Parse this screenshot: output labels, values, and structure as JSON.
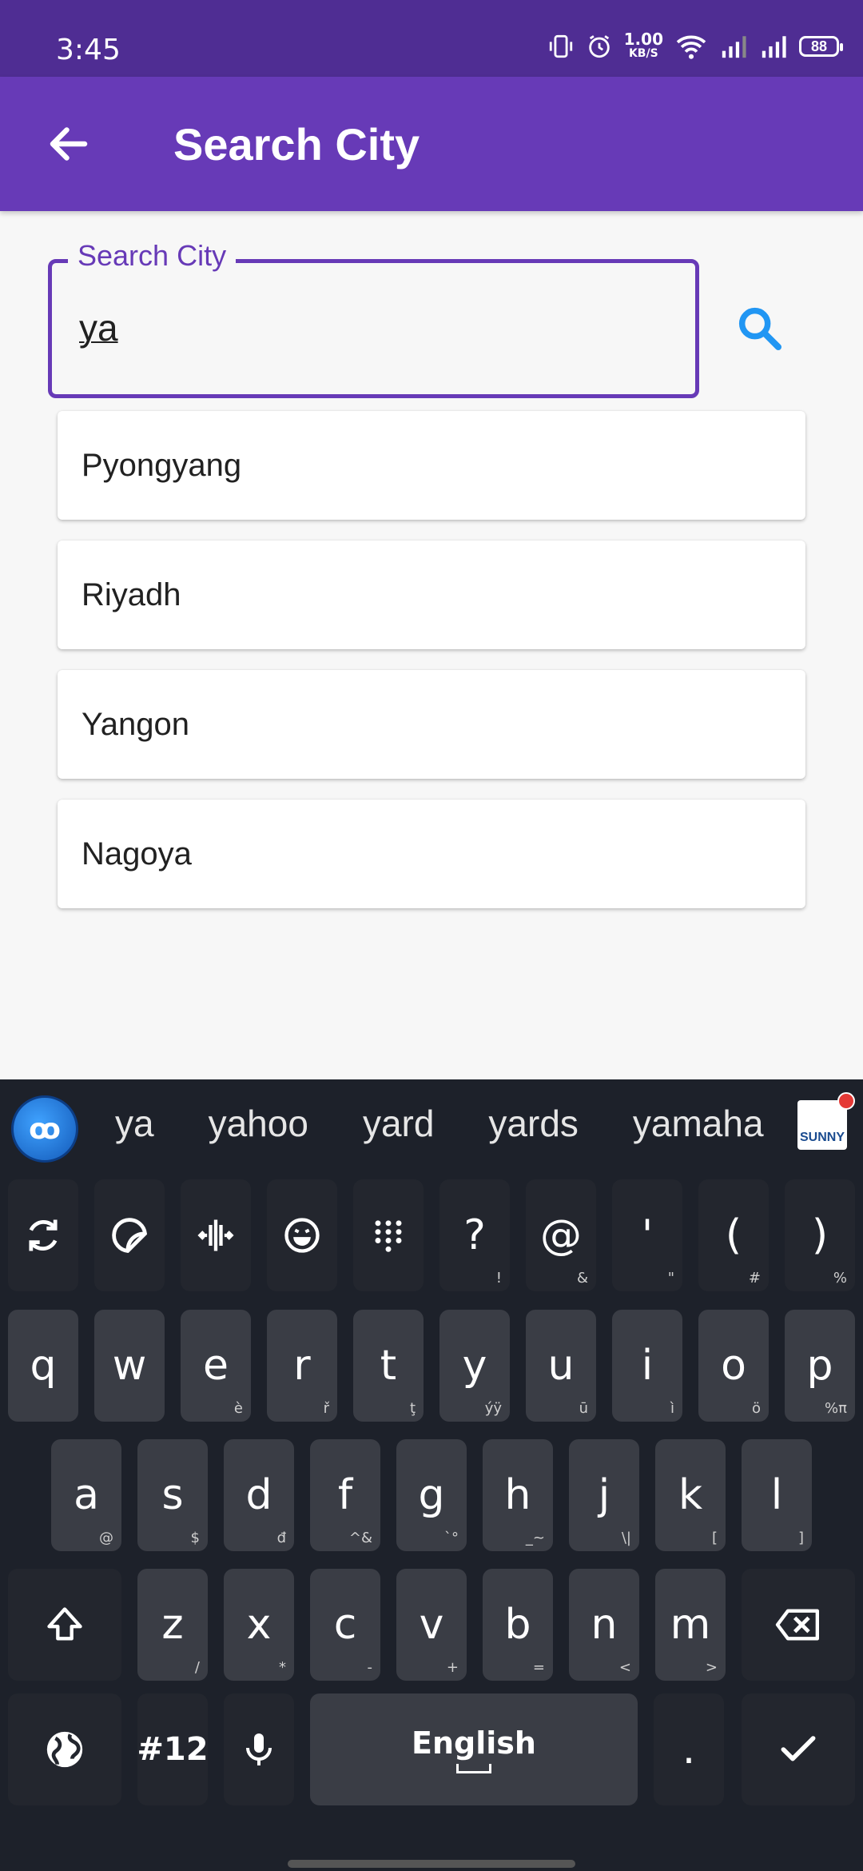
{
  "status_bar": {
    "time": "3:45",
    "net_speed_value": "1.00",
    "net_speed_unit": "KB/S",
    "battery": "88",
    "icons": [
      "vibrate-icon",
      "alarm-icon",
      "wifi-icon",
      "signal-icon",
      "signal-icon"
    ]
  },
  "app_bar": {
    "title": "Search City",
    "back_icon": "arrow-left-icon"
  },
  "search": {
    "label": "Search City",
    "value": "ya",
    "button_icon": "search-icon"
  },
  "results": [
    {
      "name": "Pyongyang"
    },
    {
      "name": "Riyadh"
    },
    {
      "name": "Yangon"
    },
    {
      "name": "Nagoya"
    }
  ],
  "keyboard": {
    "suggestions": [
      "ya",
      "yahoo",
      "yard",
      "yards",
      "yamaha"
    ],
    "badge_text": "SUNNY",
    "tool_row": [
      {
        "icon": "sync-icon"
      },
      {
        "icon": "sticker-icon"
      },
      {
        "icon": "cursor-move-icon"
      },
      {
        "icon": "emoji-icon"
      },
      {
        "icon": "numpad-icon"
      },
      {
        "label": "?",
        "sub": "!"
      },
      {
        "label": "@",
        "sub": "&"
      },
      {
        "label": "'",
        "sub": "\""
      },
      {
        "label": "(",
        "sub": "#"
      },
      {
        "label": ")",
        "sub": "%"
      }
    ],
    "row1": [
      {
        "label": "q",
        "sub": ""
      },
      {
        "label": "w",
        "sub": ""
      },
      {
        "label": "e",
        "sub": "è"
      },
      {
        "label": "r",
        "sub": "ř"
      },
      {
        "label": "t",
        "sub": "ţ"
      },
      {
        "label": "y",
        "sub": "ýÿ"
      },
      {
        "label": "u",
        "sub": "ū"
      },
      {
        "label": "i",
        "sub": "ì"
      },
      {
        "label": "o",
        "sub": "ö"
      },
      {
        "label": "p",
        "sub": "%π"
      }
    ],
    "row2": [
      {
        "label": "a",
        "sub": "@"
      },
      {
        "label": "s",
        "sub": "$"
      },
      {
        "label": "d",
        "sub": "đ"
      },
      {
        "label": "f",
        "sub": "^&"
      },
      {
        "label": "g",
        "sub": "`°"
      },
      {
        "label": "h",
        "sub": "_~"
      },
      {
        "label": "j",
        "sub": "\\|"
      },
      {
        "label": "k",
        "sub": "["
      },
      {
        "label": "l",
        "sub": "]"
      }
    ],
    "row3": [
      {
        "label": "z",
        "sub": "/"
      },
      {
        "label": "x",
        "sub": "*"
      },
      {
        "label": "c",
        "sub": "-"
      },
      {
        "label": "v",
        "sub": "+"
      },
      {
        "label": "b",
        "sub": "="
      },
      {
        "label": "n",
        "sub": "<"
      },
      {
        "label": "m",
        "sub": ">"
      }
    ],
    "shift_icon": "shift-icon",
    "backspace_icon": "backspace-icon",
    "globe_icon": "globe-icon",
    "numbers_label": "#12",
    "mic_icon": "microphone-icon",
    "space_label": "English",
    "period_label": ".",
    "enter_icon": "check-icon"
  }
}
